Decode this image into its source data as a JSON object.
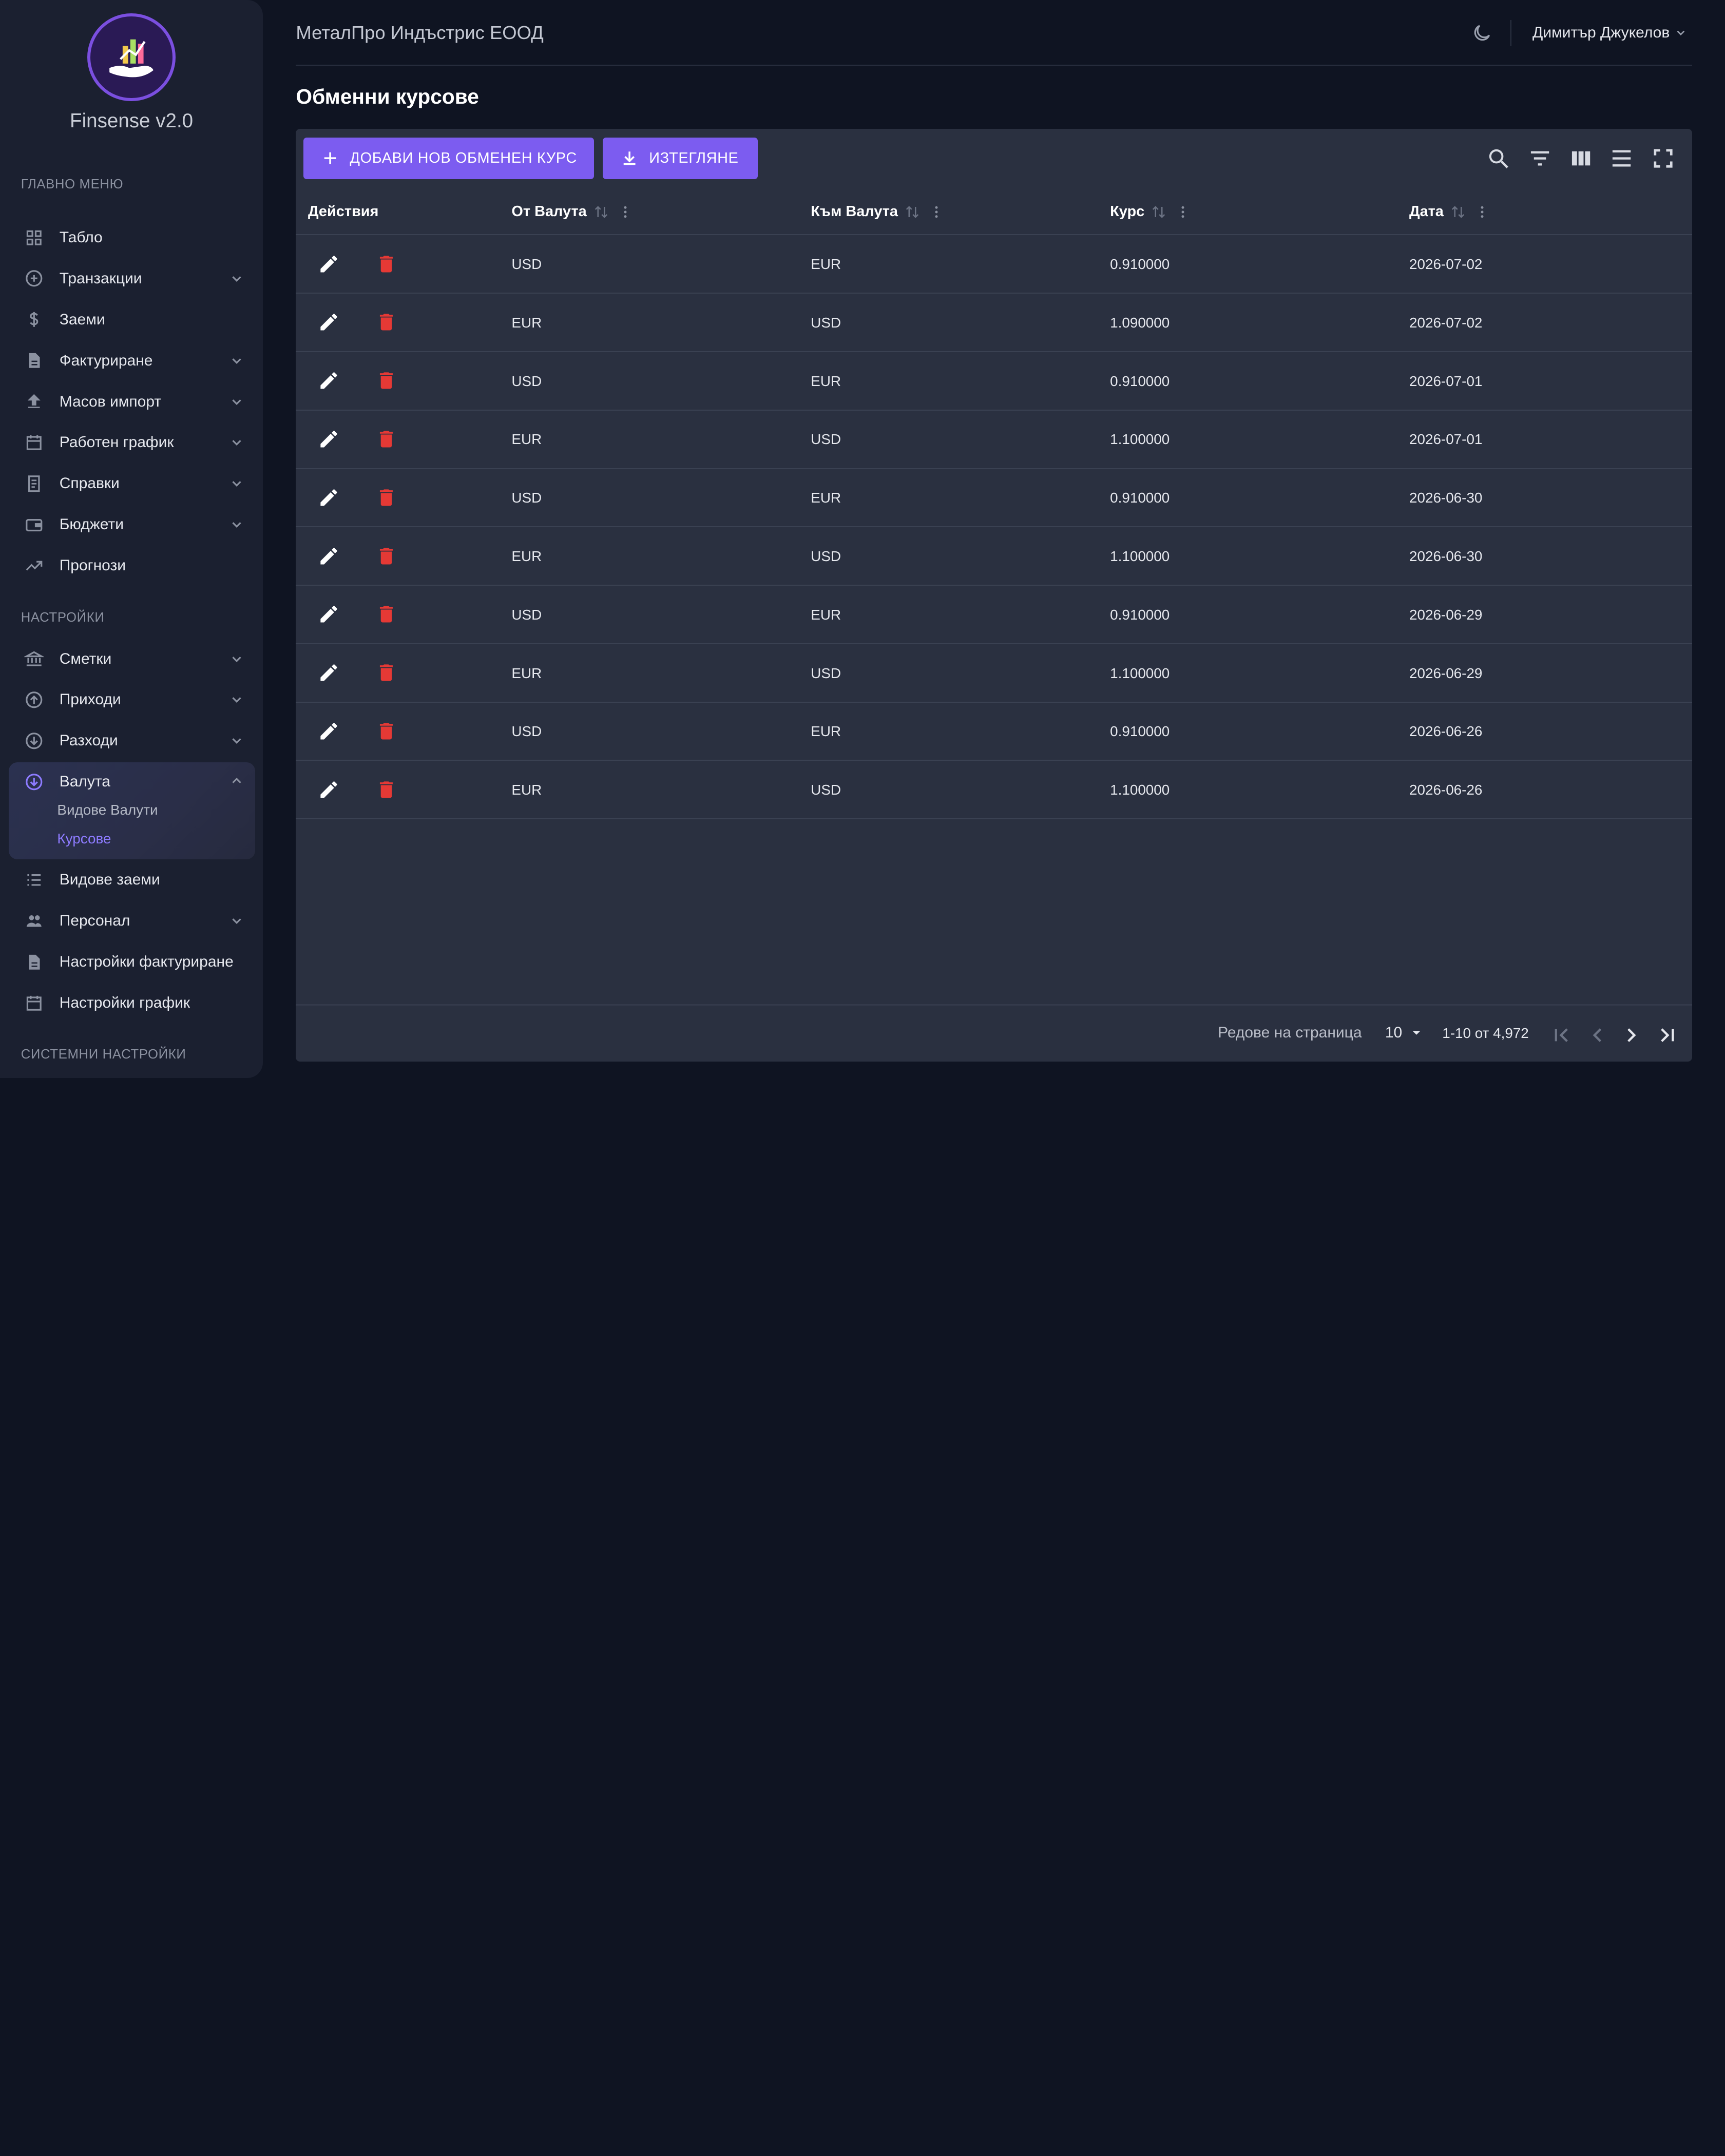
{
  "brand": {
    "name": "Finsense v2.0"
  },
  "sidebar": {
    "main_label": "ГЛАВНО МЕНЮ",
    "main_items": [
      {
        "label": "Табло",
        "icon": "dashboard-icon",
        "expandable": false
      },
      {
        "label": "Транзакции",
        "icon": "plus-circle-icon",
        "expandable": true
      },
      {
        "label": "Заеми",
        "icon": "dollar-icon",
        "expandable": false
      },
      {
        "label": "Фактуриране",
        "icon": "document-icon",
        "expandable": true
      },
      {
        "label": "Масов импорт",
        "icon": "upload-icon",
        "expandable": true
      },
      {
        "label": "Работен график",
        "icon": "calendar-icon",
        "expandable": true
      },
      {
        "label": "Справки",
        "icon": "receipt-icon",
        "expandable": true
      },
      {
        "label": "Бюджети",
        "icon": "wallet-icon",
        "expandable": true
      },
      {
        "label": "Прогнози",
        "icon": "trending-up-icon",
        "expandable": false
      }
    ],
    "settings_label": "НАСТРОЙКИ",
    "settings_items": [
      {
        "label": "Сметки",
        "icon": "bank-icon",
        "expandable": true
      },
      {
        "label": "Приходи",
        "icon": "arrow-up-circle-icon",
        "expandable": true
      },
      {
        "label": "Разходи",
        "icon": "arrow-down-circle-icon",
        "expandable": true
      }
    ],
    "active_group": {
      "label": "Валута",
      "icon": "currency-circle-icon",
      "children": [
        {
          "label": "Видове Валути",
          "active": false
        },
        {
          "label": "Курсове",
          "active": true
        }
      ]
    },
    "settings_items_after": [
      {
        "label": "Видове заеми",
        "icon": "list-icon",
        "expandable": false
      },
      {
        "label": "Персонал",
        "icon": "people-icon",
        "expandable": true
      },
      {
        "label": "Настройки фактуриране",
        "icon": "document-icon",
        "expandable": false
      },
      {
        "label": "Настройки график",
        "icon": "calendar-icon",
        "expandable": false
      }
    ],
    "system_label": "СИСТЕМНИ НАСТРОЙКИ"
  },
  "header": {
    "company": "МеталПро Индъстрис ЕООД",
    "user": "Димитър Джукелов"
  },
  "page": {
    "title": "Обменни курсове"
  },
  "toolbar": {
    "add_label": "ДОБАВИ НОВ ОБМЕНЕН КУРС",
    "export_label": "ИЗТЕГЛЯНЕ",
    "accent": "#7c5cf0"
  },
  "table": {
    "headers": {
      "actions": "Действия",
      "from": "От Валута",
      "to": "Към Валута",
      "rate": "Курс",
      "date": "Дата"
    },
    "rows": [
      {
        "from": "USD",
        "to": "EUR",
        "rate": "0.910000",
        "date": "2026-07-02"
      },
      {
        "from": "EUR",
        "to": "USD",
        "rate": "1.090000",
        "date": "2026-07-02"
      },
      {
        "from": "USD",
        "to": "EUR",
        "rate": "0.910000",
        "date": "2026-07-01"
      },
      {
        "from": "EUR",
        "to": "USD",
        "rate": "1.100000",
        "date": "2026-07-01"
      },
      {
        "from": "USD",
        "to": "EUR",
        "rate": "0.910000",
        "date": "2026-06-30"
      },
      {
        "from": "EUR",
        "to": "USD",
        "rate": "1.100000",
        "date": "2026-06-30"
      },
      {
        "from": "USD",
        "to": "EUR",
        "rate": "0.910000",
        "date": "2026-06-29"
      },
      {
        "from": "EUR",
        "to": "USD",
        "rate": "1.100000",
        "date": "2026-06-29"
      },
      {
        "from": "USD",
        "to": "EUR",
        "rate": "0.910000",
        "date": "2026-06-26"
      },
      {
        "from": "EUR",
        "to": "USD",
        "rate": "1.100000",
        "date": "2026-06-26"
      }
    ]
  },
  "pagination": {
    "rows_per_page_label": "Редове на страница",
    "rows_per_page": "10",
    "range": "1-10 от 4,972"
  },
  "colors": {
    "delete": "#e53935",
    "active_link": "#8d7bff"
  }
}
